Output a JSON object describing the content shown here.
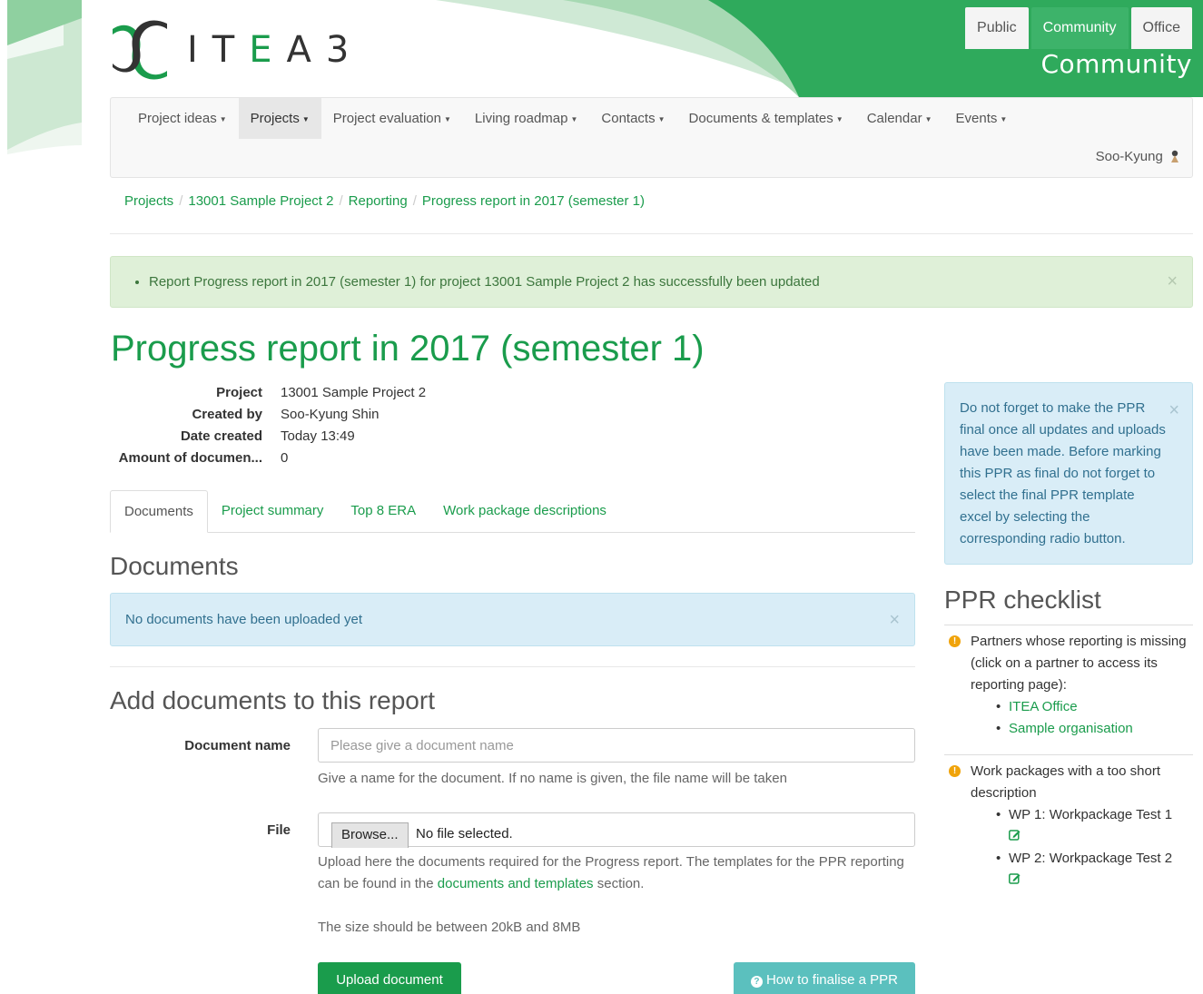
{
  "brand": {
    "logo_text": "ITEA 3",
    "site_heading": "Community"
  },
  "site_tabs": [
    {
      "label": "Public",
      "active": false
    },
    {
      "label": "Community",
      "active": true
    },
    {
      "label": "Office",
      "active": false
    }
  ],
  "nav": {
    "items": [
      {
        "label": "Project ideas"
      },
      {
        "label": "Projects"
      },
      {
        "label": "Project evaluation"
      },
      {
        "label": "Living roadmap"
      },
      {
        "label": "Contacts"
      },
      {
        "label": "Documents & templates"
      },
      {
        "label": "Calendar"
      },
      {
        "label": "Events"
      }
    ],
    "user": "Soo-Kyung"
  },
  "breadcrumb": [
    "Projects",
    "13001 Sample Project 2",
    "Reporting",
    "Progress report in 2017 (semester 1)"
  ],
  "alert_success": "Report Progress report in 2017 (semester 1) for project 13001 Sample Project 2 has successfully been updated",
  "page_title": "Progress report in 2017 (semester 1)",
  "details": [
    {
      "label": "Project",
      "value": "13001 Sample Project 2"
    },
    {
      "label": "Created by",
      "value": "Soo-Kyung Shin"
    },
    {
      "label": "Date created",
      "value": "Today 13:49"
    },
    {
      "label": "Amount of documen...",
      "value": "0"
    }
  ],
  "tabs": [
    {
      "label": "Documents",
      "active": true
    },
    {
      "label": "Project summary",
      "active": false
    },
    {
      "label": "Top 8 ERA",
      "active": false
    },
    {
      "label": "Work package descriptions",
      "active": false
    }
  ],
  "documents": {
    "heading": "Documents",
    "empty_message": "No documents have been uploaded yet"
  },
  "add_form": {
    "heading": "Add documents to this report",
    "name_label": "Document name",
    "name_placeholder": "Please give a document name",
    "name_help": "Give a name for the document. If no name is given, the file name will be taken",
    "file_label": "File",
    "browse_label": "Browse...",
    "no_file": "No file selected.",
    "file_help_pre": "Upload here the documents required for the Progress report. The templates for the PPR reporting can be found in the ",
    "file_help_link": "documents and templates",
    "file_help_post": " section.",
    "size_help": "The size should be between 20kB and 8MB",
    "upload_button": "Upload document",
    "howto_button": "How to finalise a PPR"
  },
  "sidebar": {
    "info": "Do not forget to make the PPR final once all updates and uploads have been made. Before marking this PPR as final do not forget to select the final PPR template excel by selecting the corresponding radio button.",
    "checklist_heading": "PPR checklist",
    "missing_reporting": {
      "text": "Partners whose reporting is missing (click on a partner to access its reporting page):",
      "partners": [
        "ITEA Office",
        "Sample organisation"
      ]
    },
    "short_description": {
      "text": "Work packages with a too short description",
      "workpackages": [
        "WP 1: Workpackage Test 1",
        "WP 2: Workpackage Test 2"
      ]
    }
  },
  "colors": {
    "brand_green": "#1a9c4c",
    "tab_active": "#3db36a",
    "info_bg": "#d9edf7",
    "success_bg": "#dff0d8",
    "warning": "#f0a30a"
  }
}
